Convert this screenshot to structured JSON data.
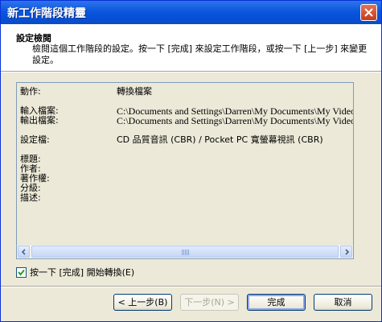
{
  "window": {
    "title": "新工作階段精靈"
  },
  "header": {
    "title": "設定檢閱",
    "description": "檢閱這個工作階段的設定。按一下 [完成] 來設定工作階段，或按一下 [上一步] 來變更設定。"
  },
  "summary": {
    "rows": [
      {
        "label": "動作:",
        "value": "轉換檔案"
      },
      {
        "label": "輸入檔案:",
        "value": "C:\\Documents and Settings\\Darren\\My Documents\\My Videos\\"
      },
      {
        "label": "輸出檔案:",
        "value": "C:\\Documents and Settings\\Darren\\My Documents\\My Videos\\"
      },
      {
        "label": "設定檔:",
        "value": "CD 品質音訊 (CBR) / Pocket PC 寬螢幕視訊 (CBR)"
      },
      {
        "label": "標題:",
        "value": ""
      },
      {
        "label": "作者:",
        "value": ""
      },
      {
        "label": "著作權:",
        "value": ""
      },
      {
        "label": "分級:",
        "value": ""
      },
      {
        "label": "描述:",
        "value": ""
      }
    ]
  },
  "checkbox": {
    "label": "按一下 [完成] 開始轉換(E)",
    "checked": true
  },
  "buttons": {
    "back": "< 上一步(B)",
    "next": "下一步(N) >",
    "finish": "完成",
    "cancel": "取消"
  }
}
